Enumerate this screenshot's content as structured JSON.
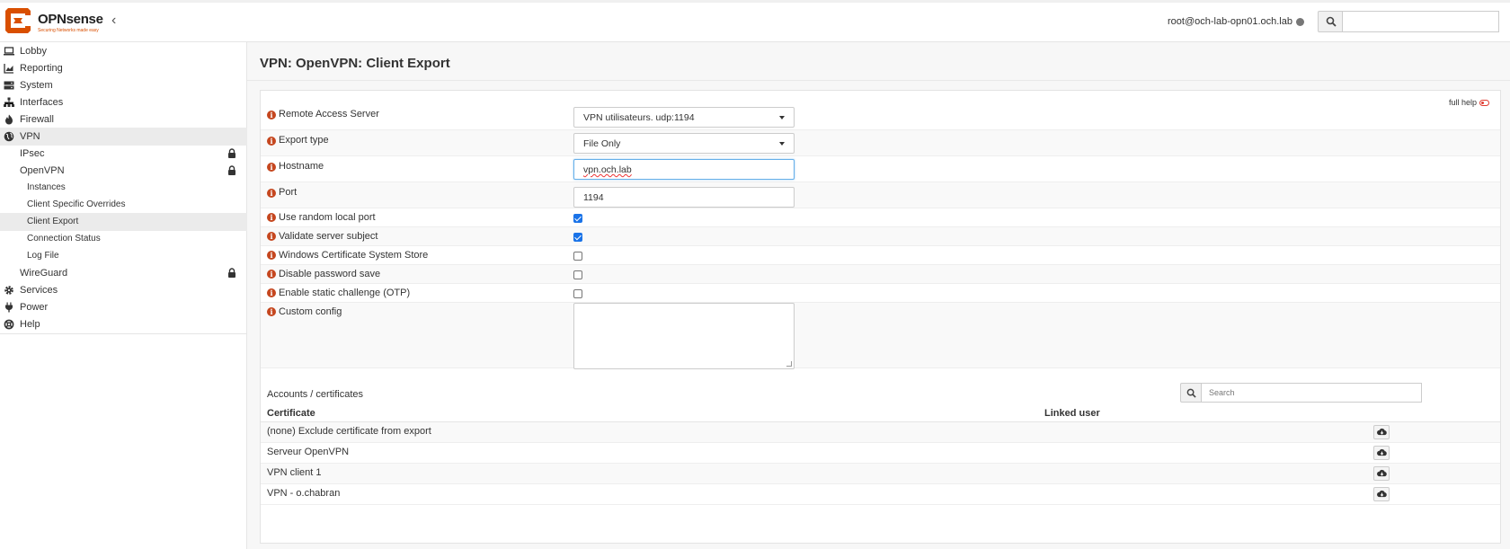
{
  "header": {
    "brand": "OPNsense",
    "tagline": "Securing Networks made easy",
    "user": "root@och-lab-opn01.och.lab"
  },
  "sidebar": {
    "items": [
      {
        "label": "Lobby",
        "icon": "laptop-icon"
      },
      {
        "label": "Reporting",
        "icon": "chart-icon"
      },
      {
        "label": "System",
        "icon": "server-icon"
      },
      {
        "label": "Interfaces",
        "icon": "sitemap-icon"
      },
      {
        "label": "Firewall",
        "icon": "fire-icon"
      },
      {
        "label": "VPN",
        "icon": "globe-icon"
      },
      {
        "label": "IPsec"
      },
      {
        "label": "OpenVPN"
      },
      {
        "label": "Instances"
      },
      {
        "label": "Client Specific Overrides"
      },
      {
        "label": "Client Export"
      },
      {
        "label": "Connection Status"
      },
      {
        "label": "Log File"
      },
      {
        "label": "WireGuard"
      },
      {
        "label": "Services",
        "icon": "gear-icon"
      },
      {
        "label": "Power",
        "icon": "plug-icon"
      },
      {
        "label": "Help",
        "icon": "lifebuoy-icon"
      }
    ]
  },
  "page": {
    "title": "VPN: OpenVPN: Client Export",
    "full_help": "full help"
  },
  "form": {
    "remote_access_server": {
      "label": "Remote Access Server",
      "value": "VPN utilisateurs. udp:1194"
    },
    "export_type": {
      "label": "Export type",
      "value": "File Only"
    },
    "hostname": {
      "label": "Hostname",
      "value": "vpn.och.lab"
    },
    "port": {
      "label": "Port",
      "value": "1194"
    },
    "use_random_local_port": {
      "label": "Use random local port",
      "checked": true
    },
    "validate_server_subject": {
      "label": "Validate server subject",
      "checked": true
    },
    "windows_cert_store": {
      "label": "Windows Certificate System Store",
      "checked": false
    },
    "disable_password_save": {
      "label": "Disable password save",
      "checked": false
    },
    "static_challenge": {
      "label": "Enable static challenge (OTP)",
      "checked": false
    },
    "custom_config": {
      "label": "Custom config",
      "value": ""
    }
  },
  "accounts": {
    "title": "Accounts / certificates",
    "search_placeholder": "Search",
    "columns": [
      "Certificate",
      "Linked user"
    ],
    "rows": [
      {
        "certificate": "(none) Exclude certificate from export",
        "linked_user": ""
      },
      {
        "certificate": "Serveur OpenVPN",
        "linked_user": ""
      },
      {
        "certificate": "VPN client 1",
        "linked_user": ""
      },
      {
        "certificate": "VPN - o.chabran",
        "linked_user": ""
      }
    ]
  },
  "colors": {
    "accent": "#d94f00",
    "info": "#c5461e",
    "checkbox": "#1a73e8"
  }
}
